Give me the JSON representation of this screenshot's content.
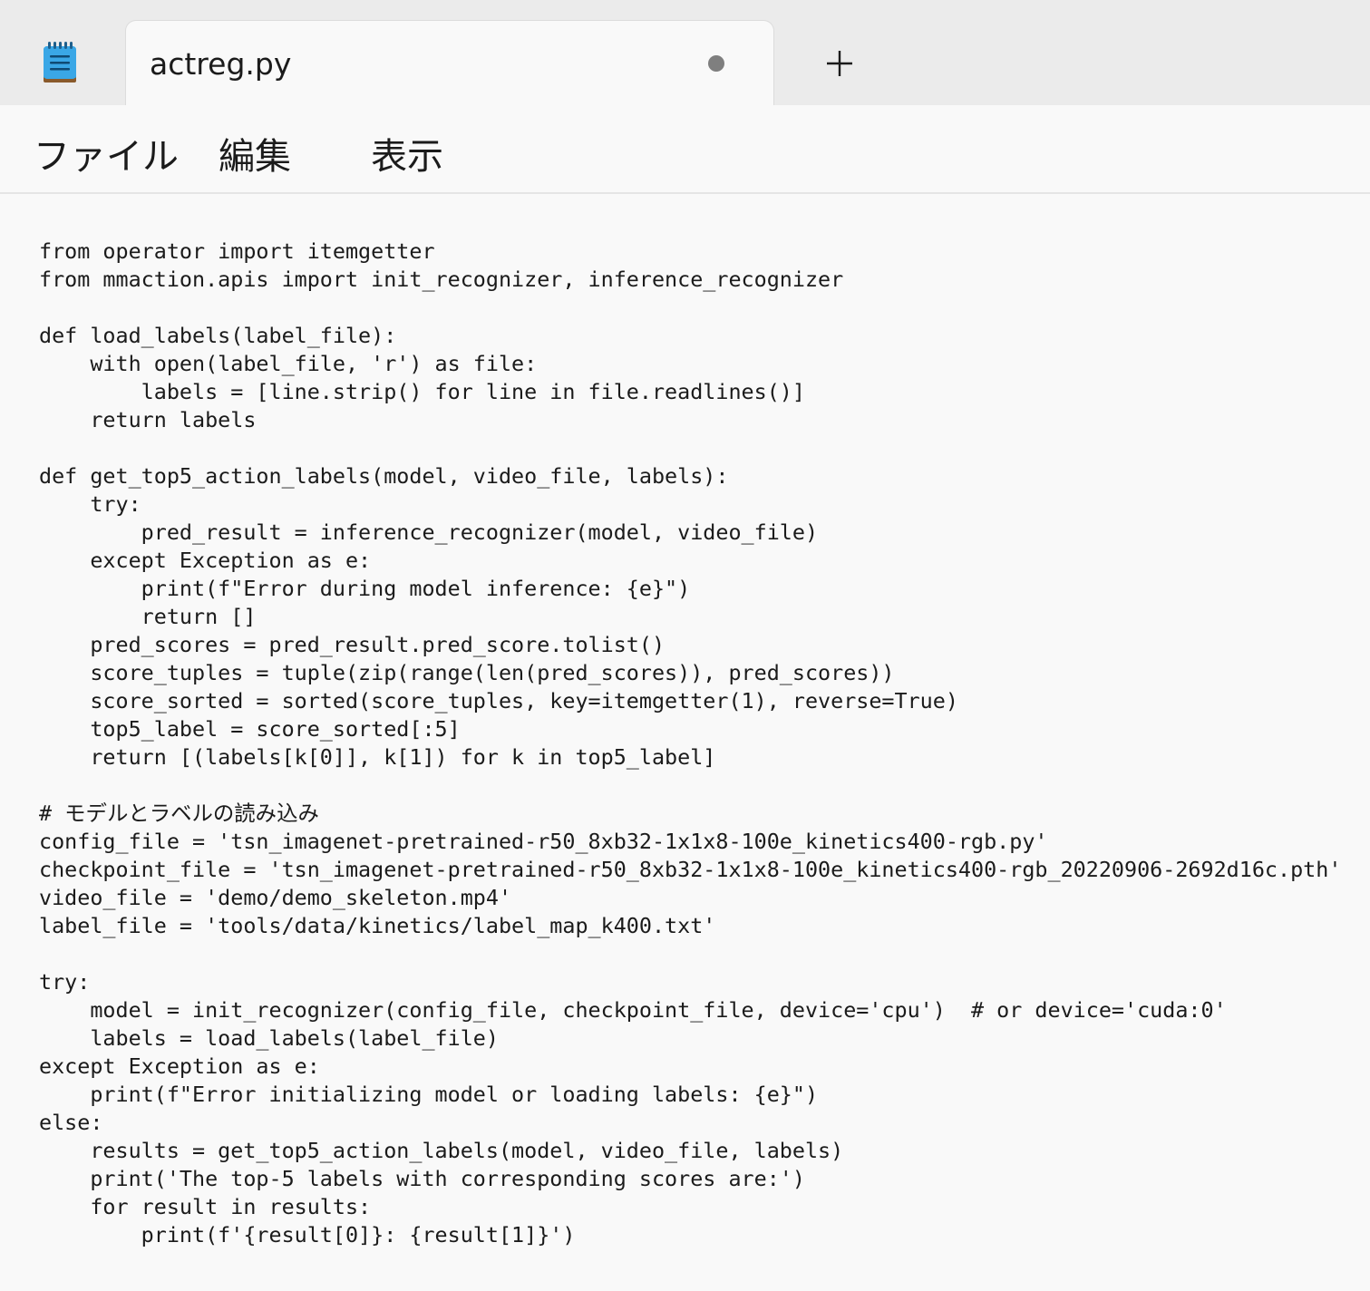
{
  "tab": {
    "title": "actreg.py"
  },
  "icons": {
    "app": "notepad-icon",
    "modified": "unsaved-dot-icon",
    "new_tab": "plus-icon"
  },
  "menu": {
    "items": [
      "ファイル",
      "編集",
      "表示"
    ]
  },
  "editor": {
    "lines": [
      "from operator import itemgetter",
      "from mmaction.apis import init_recognizer, inference_recognizer",
      "",
      "def load_labels(label_file):",
      "    with open(label_file, 'r') as file:",
      "        labels = [line.strip() for line in file.readlines()]",
      "    return labels",
      "",
      "def get_top5_action_labels(model, video_file, labels):",
      "    try:",
      "        pred_result = inference_recognizer(model, video_file)",
      "    except Exception as e:",
      "        print(f\"Error during model inference: {e}\")",
      "        return []",
      "    pred_scores = pred_result.pred_score.tolist()",
      "    score_tuples = tuple(zip(range(len(pred_scores)), pred_scores))",
      "    score_sorted = sorted(score_tuples, key=itemgetter(1), reverse=True)",
      "    top5_label = score_sorted[:5]",
      "    return [(labels[k[0]], k[1]) for k in top5_label]",
      "",
      "# モデルとラベルの読み込み",
      "config_file = 'tsn_imagenet-pretrained-r50_8xb32-1x1x8-100e_kinetics400-rgb.py'",
      "checkpoint_file = 'tsn_imagenet-pretrained-r50_8xb32-1x1x8-100e_kinetics400-rgb_20220906-2692d16c.pth'",
      "video_file = 'demo/demo_skeleton.mp4'",
      "label_file = 'tools/data/kinetics/label_map_k400.txt'",
      "",
      "try:",
      "    model = init_recognizer(config_file, checkpoint_file, device='cpu')  # or device='cuda:0'",
      "    labels = load_labels(label_file)",
      "except Exception as e:",
      "    print(f\"Error initializing model or loading labels: {e}\")",
      "else:",
      "    results = get_top5_action_labels(model, video_file, labels)",
      "    print('The top-5 labels with corresponding scores are:')",
      "    for result in results:",
      "        print(f'{result[0]}: {result[1]}')"
    ]
  }
}
